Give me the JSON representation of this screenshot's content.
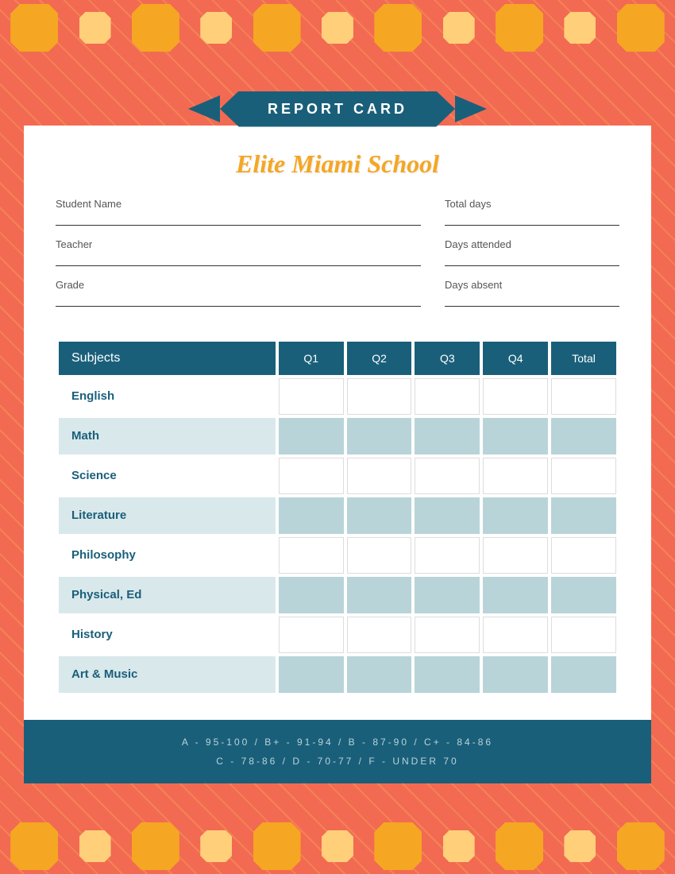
{
  "page": {
    "background_color": "#f26a52"
  },
  "banner": {
    "title": "REPORT CARD"
  },
  "school": {
    "name": "Elite Miami School"
  },
  "info_fields": {
    "left": [
      {
        "label": "Student Name"
      },
      {
        "label": "Teacher"
      },
      {
        "label": "Grade"
      }
    ],
    "right": [
      {
        "label": "Total days"
      },
      {
        "label": "Days attended"
      },
      {
        "label": "Days absent"
      }
    ]
  },
  "table": {
    "headers": [
      "Subjects",
      "Q1",
      "Q2",
      "Q3",
      "Q4",
      "Total"
    ],
    "rows": [
      {
        "subject": "English",
        "tinted": false
      },
      {
        "subject": "Math",
        "tinted": true
      },
      {
        "subject": "Science",
        "tinted": false
      },
      {
        "subject": "Literature",
        "tinted": true
      },
      {
        "subject": "Philosophy",
        "tinted": false
      },
      {
        "subject": "Physical, Ed",
        "tinted": true
      },
      {
        "subject": "History",
        "tinted": false
      },
      {
        "subject": "Art & Music",
        "tinted": true
      }
    ]
  },
  "footer": {
    "line1": "A - 95-100  /  B+ - 91-94  /  B - 87-90  /  C+ - 84-86",
    "line2": "C - 78-86  /  D - 70-77  /  F - UNDER 70"
  }
}
